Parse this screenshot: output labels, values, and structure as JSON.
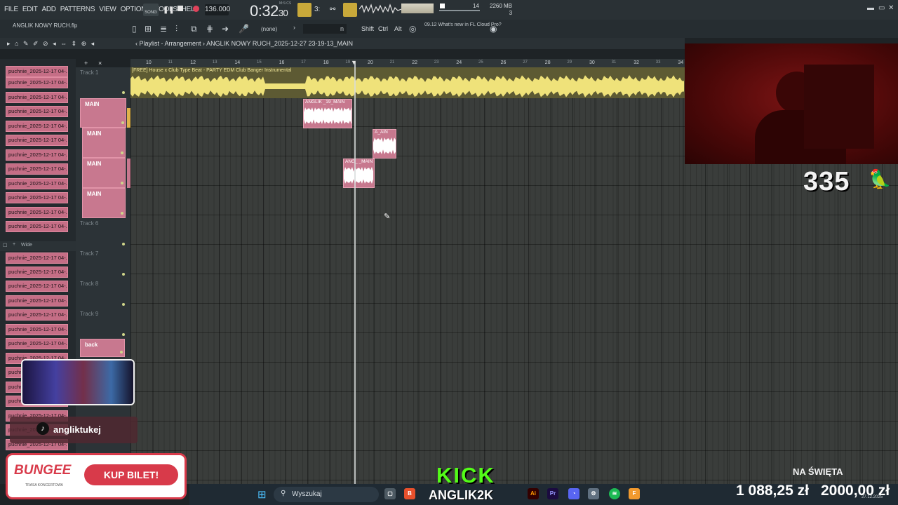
{
  "menu": [
    "FILE",
    "EDIT",
    "ADD",
    "PATTERNS",
    "VIEW",
    "OPTIONS",
    "TOOLS",
    "HELP"
  ],
  "transport": {
    "mode": "SONG",
    "tempo": "136.000",
    "time_main": "0:32",
    "time_sub": "30",
    "time_unit": "M:S:CS"
  },
  "monitor": {
    "cpu": "14",
    "memory": "2260 MB",
    "polyphony": "3"
  },
  "toolbar": {
    "filename": "ANGLIK NOWY RUCH.flp",
    "snap": "(none)",
    "pattern": "n",
    "mod_shift": "Shift",
    "mod_ctrl": "Ctrl",
    "mod_alt": "Alt",
    "news_time": "09.12",
    "news_text": "What's new in FL Cloud Pro?"
  },
  "playlist": {
    "title": "Playlist - Arrangement",
    "arrangement": "ANGLIK NOWY RUCH_2025-12-27 23-19-13_MAIN"
  },
  "picker": {
    "clip_label": "puchnie_2025-12-17 04-..",
    "wide_label": "Wide"
  },
  "tracks": [
    {
      "label": "Track 1",
      "pink": false
    },
    {
      "label": "MAIN",
      "pink": true
    },
    {
      "label": "MAIN",
      "pink": true
    },
    {
      "label": "MAIN",
      "pink": true
    },
    {
      "label": "MAIN",
      "pink": true
    },
    {
      "label": "Track 6",
      "pink": false
    },
    {
      "label": "Track 7",
      "pink": false
    },
    {
      "label": "Track 8",
      "pink": false
    },
    {
      "label": "Track 9",
      "pink": false
    },
    {
      "label": "back",
      "pink": true
    }
  ],
  "ruler": [
    "10",
    "11",
    "12",
    "13",
    "14",
    "15",
    "16",
    "17",
    "18",
    "19",
    "20",
    "21",
    "22",
    "23",
    "24",
    "25",
    "26",
    "27",
    "28",
    "29",
    "30",
    "31",
    "32",
    "33",
    "34"
  ],
  "clips": {
    "audio_title": "[FREE] House x Club Type Beat - PARTY EDM Club Banger Instrumental",
    "clip1": "ANGLIK _19_MAIN",
    "clip2": "A_AIN",
    "clip3": "ANG_ _MAIN"
  },
  "overlay": {
    "counter": "335",
    "tiktok": "angliktukej",
    "bungee": "BUNGEE",
    "bungee_sub": "TRASA KONCERTOWA",
    "kup": "KUP BILET!",
    "kick": "KICK",
    "kick_name": "ANGLIK2K",
    "na_swieta": "NA ŚWIĘTA",
    "money1": "1 088,25 zł",
    "money2": "2000,00 zł",
    "date": "27.12.2025"
  },
  "taskbar": {
    "search": "Wyszukaj"
  },
  "colors": {
    "clip_pink": "#c7788e",
    "audio_yellow": "#efe27a",
    "grid": "#3a3d3b",
    "kick_green": "#53fc18"
  }
}
